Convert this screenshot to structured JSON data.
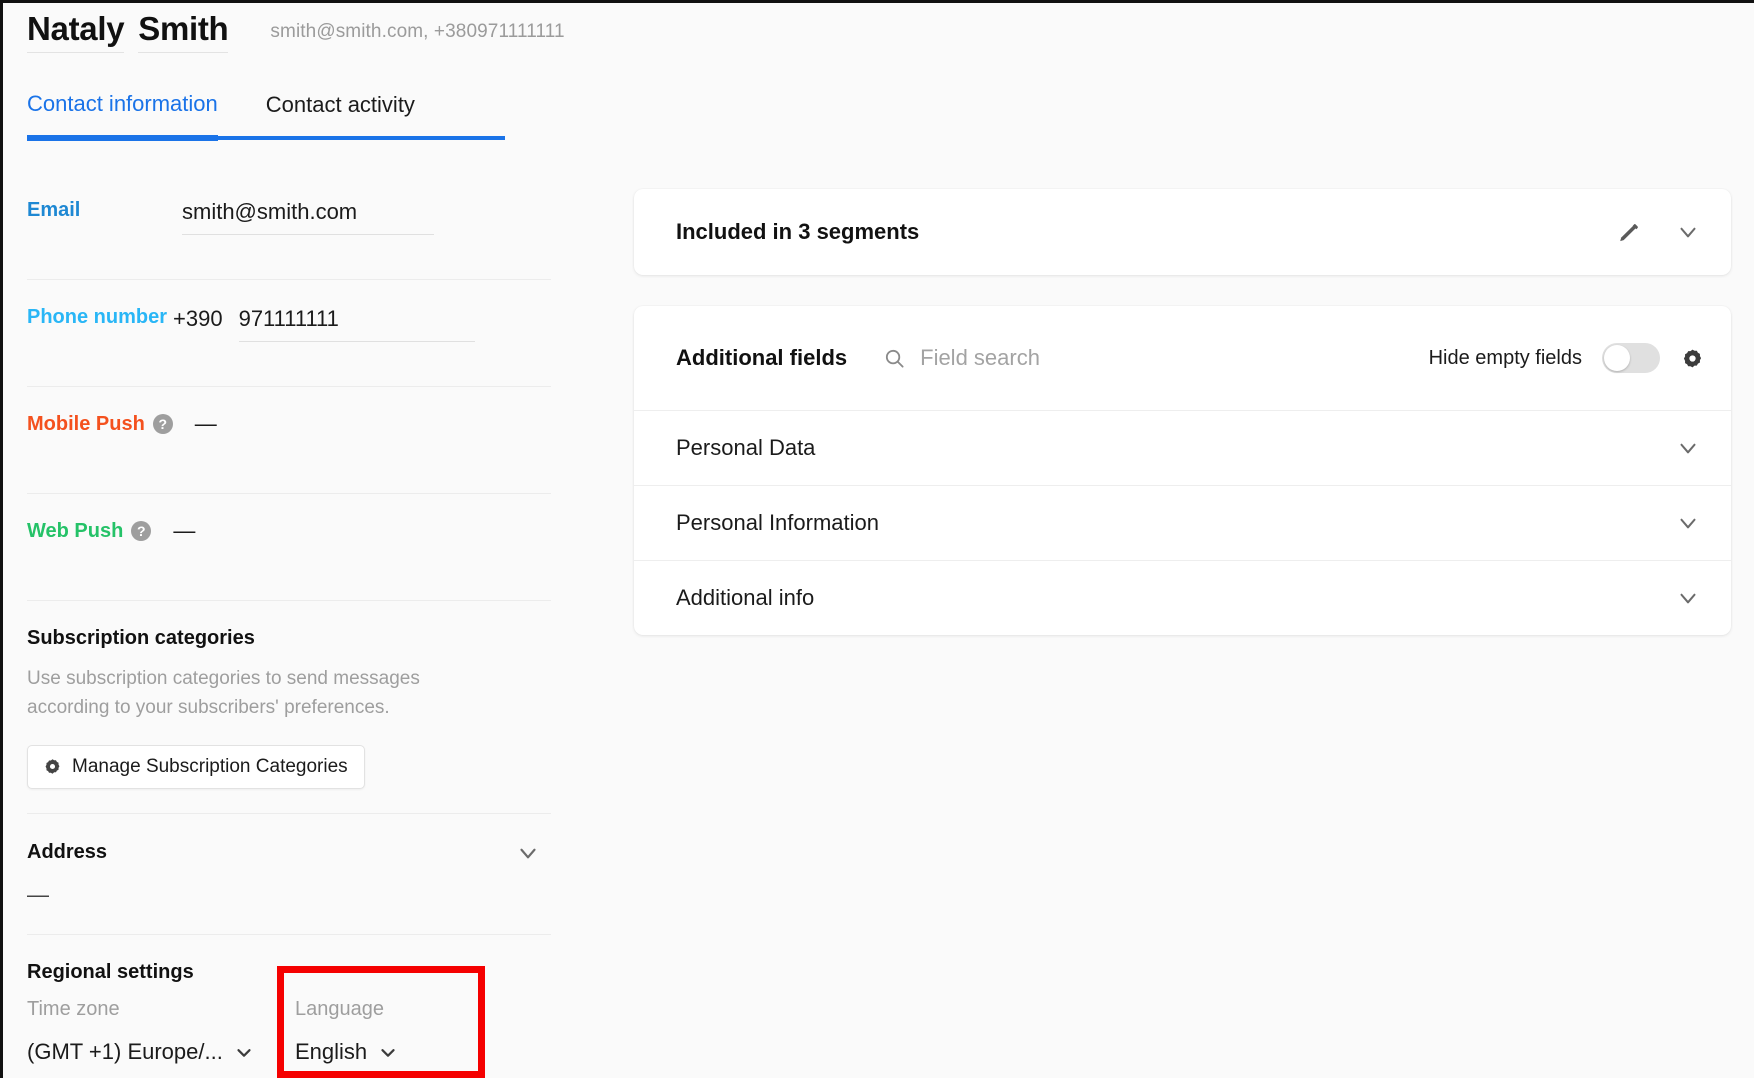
{
  "header": {
    "first_name": "Nataly",
    "last_name": "Smith",
    "contacts_summary": "smith@smith.com, +380971111111"
  },
  "tabs": [
    {
      "label": "Contact information",
      "active": true
    },
    {
      "label": "Contact activity",
      "active": false
    }
  ],
  "contact_information": {
    "email": {
      "label": "Email",
      "value": "smith@smith.com",
      "placeholder": "Email"
    },
    "phone": {
      "label": "Phone number",
      "prefix": "+390",
      "value": "971111111",
      "placeholder": "Phone number"
    },
    "mobile_push": {
      "label": "Mobile Push",
      "help_icon": "question-mark-icon",
      "value": "—"
    },
    "web_push": {
      "label": "Web Push",
      "help_icon": "question-mark-icon",
      "value": "—"
    },
    "subscription_categories": {
      "title": "Subscription categories",
      "description": "Use subscription categories to send messages according to your subscribers' preferences.",
      "button_label": "Manage Subscription Categories",
      "button_icon": "gear-icon"
    },
    "address": {
      "title": "Address",
      "value": "—",
      "chevron_icon": "chevron-down-icon"
    },
    "regional_settings": {
      "title": "Regional settings",
      "time_zone": {
        "label": "Time zone",
        "value": "(GMT +1) Europe/...",
        "chevron_icon": "chevron-down-icon"
      },
      "language": {
        "label": "Language",
        "value": "English",
        "chevron_icon": "chevron-down-icon"
      }
    }
  },
  "segments_card": {
    "text": "Included in  3  segments",
    "edit_icon": "pencil-icon",
    "chevron_icon": "chevron-down-icon"
  },
  "additional_fields_card": {
    "title": "Additional fields",
    "search_icon": "search-icon",
    "search_value": "",
    "search_placeholder": "Field search",
    "hide_empty_label": "Hide empty fields",
    "hide_empty_enabled": false,
    "settings_icon": "gear-icon",
    "groups": [
      {
        "label": "Personal Data",
        "chevron_icon": "chevron-down-icon"
      },
      {
        "label": "Personal Information",
        "chevron_icon": "chevron-down-icon"
      },
      {
        "label": "Additional info",
        "chevron_icon": "chevron-down-icon"
      }
    ]
  },
  "annotation": {
    "highlight_color": "#f50000",
    "highlight_target": "language-select"
  },
  "colors": {
    "accent_blue": "#1a73e8",
    "email_label": "#1e88d3",
    "phone_label": "#29b6f6",
    "mobile_push_label": "#f4511e",
    "web_push_label": "#25c268",
    "page_background": "#fafafa",
    "card_background": "#ffffff"
  }
}
